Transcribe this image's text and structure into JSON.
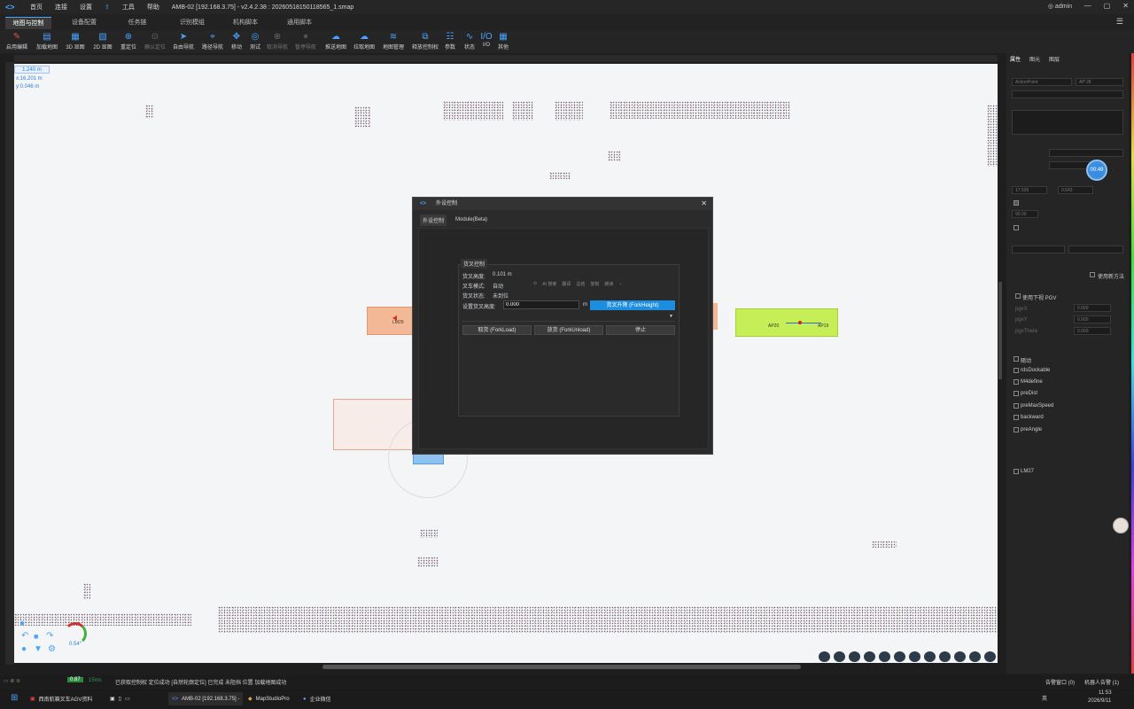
{
  "titlebar": {
    "menu": [
      "首页",
      "连接",
      "设置",
      "工具",
      "帮助"
    ],
    "title": "AMB-02 [192.168.3.75] - v2.4.2.38 : 20260518150118565_1.smap",
    "user": "admin"
  },
  "tabs": [
    "地图与控制",
    "设备配置",
    "任务链",
    "识别模组",
    "机构脚本",
    "通用脚本"
  ],
  "toolbar": [
    {
      "label": "启用编辑",
      "icon": "pencil-icon"
    },
    {
      "label": "加载地图",
      "icon": "map-icon"
    },
    {
      "label": "3D 显图",
      "icon": "view3d-icon"
    },
    {
      "label": "2D 显图",
      "icon": "view2d-icon"
    },
    {
      "label": "重定位",
      "icon": "locate-icon"
    },
    {
      "label": "确认定位",
      "icon": "check-icon",
      "disabled": true
    },
    {
      "label": "自由导航",
      "icon": "navigate-icon"
    },
    {
      "label": "路径导航",
      "icon": "pin-icon"
    },
    {
      "label": "移动",
      "icon": "move-icon"
    },
    {
      "label": "测试",
      "icon": "test-icon"
    },
    {
      "label": "取消导航",
      "icon": "cancel-icon",
      "disabled": true
    },
    {
      "label": "暂停导航",
      "icon": "pause-icon",
      "disabled": true
    },
    {
      "label": "推送地图",
      "icon": "upload-cloud-icon"
    },
    {
      "label": "拉取地图",
      "icon": "download-cloud-icon"
    },
    {
      "label": "地图管理",
      "icon": "layers-icon"
    },
    {
      "label": "释放控制权",
      "icon": "release-icon"
    },
    {
      "label": "参数",
      "icon": "params-icon"
    },
    {
      "label": "状态",
      "icon": "status-icon"
    },
    {
      "label": "I/O",
      "icon": "io-icon"
    },
    {
      "label": "其他",
      "icon": "grid-icon"
    }
  ],
  "canvas": {
    "scale": "1.240 m",
    "x": "x:16.201 m",
    "y": "y:0.046 m",
    "labels": {
      "lm29": "LM29",
      "ap20": "AP20",
      "ap19": "AP19"
    },
    "gauge": "0.54°"
  },
  "dialog": {
    "title": "外设控制",
    "tabs": [
      "外设控制",
      "Module(Beta)"
    ],
    "section": "货叉控制",
    "fork_height_label": "货叉高度:",
    "fork_height_value": "0.101 m",
    "fork_mode_label": "叉车模式:",
    "fork_mode_value": "自动",
    "fork_status_label": "货叉状态:",
    "fork_status_value": "未到位",
    "set_height_label": "设置货叉高度:",
    "set_height_value": "0.000",
    "unit": "m",
    "lift_button": "货叉升降 (ForkHeight)",
    "load_button": "取货 (ForkLoad)",
    "unload_button": "放货 (ForkUnload)",
    "stop_button": "停止",
    "float_toolbar": [
      "AI 搜索",
      "翻译",
      "总结",
      "复制",
      "朗读"
    ]
  },
  "rpanel": {
    "tabs": [
      "属性",
      "图元",
      "图层"
    ],
    "point_type": "ActionPoint",
    "point_name": "AP 28",
    "time_badge": "00:49",
    "fields": [
      "17.505",
      "0.643",
      "90.00"
    ],
    "use_new_method": "使用新方法",
    "use_pgv": "使用下视 PGV",
    "pgv_fields": [
      "0.000",
      "0.000",
      "0.000"
    ],
    "pgv_labels": [
      "pgvX",
      "pgvY",
      "pgvTheta"
    ],
    "checks": [
      "随动",
      "rdsDockable",
      "M4define",
      "preDist",
      "preMaxSpeed",
      "backward",
      "preAngle"
    ],
    "link": "LM27"
  },
  "status": {
    "left": "已获取控制权  定位成功 [自然轮廓定位]  已完成  未阻挡  位置  加载地图成功",
    "value_badge": "0.87",
    "ms": "15ms",
    "log": "告警窗口 (0)",
    "robot_msg": "机器人告警 (1)"
  },
  "taskbar": {
    "items": [
      "西南航箱叉车AGV资料",
      "AMB-02 [192.168.3.75] -",
      "MapStudioPro",
      "企业微信"
    ],
    "time": "11:53",
    "date": "2026/9/11",
    "lang": "英"
  }
}
